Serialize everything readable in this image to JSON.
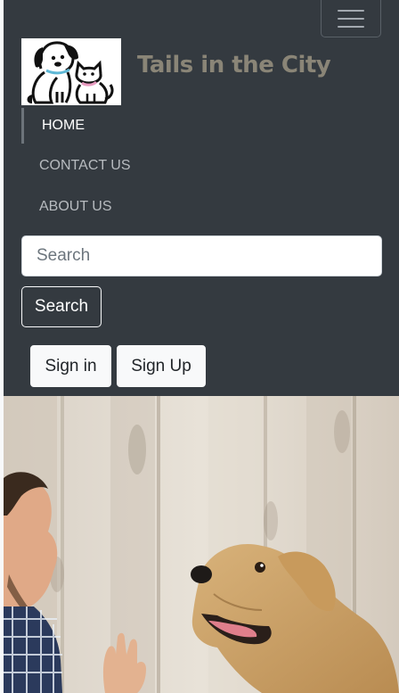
{
  "brand": {
    "title": "Tails in the City",
    "logo_icon": "dog-and-cat-logo"
  },
  "navbar": {
    "toggler_icon": "hamburger-menu-icon",
    "items": [
      {
        "label": "HOME",
        "active": true
      },
      {
        "label": "CONTACT US",
        "active": false
      },
      {
        "label": "ABOUT US",
        "active": false
      }
    ]
  },
  "search": {
    "placeholder": "Search",
    "value": "",
    "button_label": "Search"
  },
  "auth": {
    "signin_label": "Sign in",
    "signup_label": "Sign Up"
  },
  "hero": {
    "image": "man-high-fiving-labrador-dog-photo"
  },
  "colors": {
    "navbar_bg": "#343a40",
    "brand_text": "#8a8577",
    "active_link": "#ffffff",
    "inactive_link": "#b7bbbf"
  }
}
